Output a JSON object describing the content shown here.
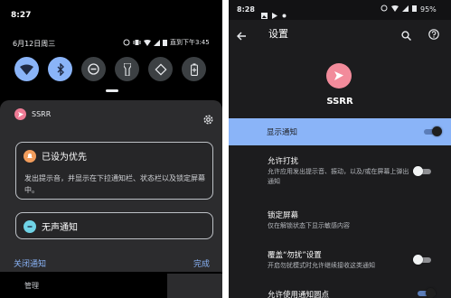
{
  "left": {
    "time": "8:27",
    "date": "6月12日周三",
    "status_text": "直到下午3:45",
    "quick_settings": [
      {
        "icon": "wifi-icon",
        "state": "on"
      },
      {
        "icon": "bluetooth-icon",
        "state": "on"
      },
      {
        "icon": "do-not-disturb-icon",
        "state": "off"
      },
      {
        "icon": "flashlight-icon",
        "state": "off"
      },
      {
        "icon": "auto-rotate-icon",
        "state": "off"
      },
      {
        "icon": "battery-saver-icon",
        "state": "off"
      }
    ],
    "app_name": "SSRR",
    "priority": {
      "title": "已设为优先",
      "description": "发出提示音，并显示在下拉通知栏、状态栏以及锁定屏幕中。"
    },
    "silent": {
      "title": "无声通知"
    },
    "close_label": "关闭通知",
    "done_label": "完成",
    "manage_label": "管理"
  },
  "right": {
    "time": "8:28",
    "battery": "95%",
    "title": "设置",
    "app_name": "SSRR",
    "items": [
      {
        "title": "显示通知",
        "desc": "",
        "toggle": true,
        "highlighted": true
      },
      {
        "title": "允许打扰",
        "desc": "允许应用发出提示音、振动，以及/或在屏幕上弹出通知",
        "toggle": false
      },
      {
        "title": "锁定屏幕",
        "desc": "仅在解锁状态下显示敏感内容"
      },
      {
        "title": "覆盖“勿扰”设置",
        "desc": "开启勿扰模式时允许继续接收这类通知",
        "toggle": false
      },
      {
        "title": "允许使用通知圆点",
        "desc": "",
        "toggle": true
      }
    ]
  },
  "colors": {
    "accent": "#8ab4f8",
    "app_icon": "#f28b9b",
    "priority_icon": "#f29d5c",
    "silent_icon": "#6fd3e6"
  }
}
